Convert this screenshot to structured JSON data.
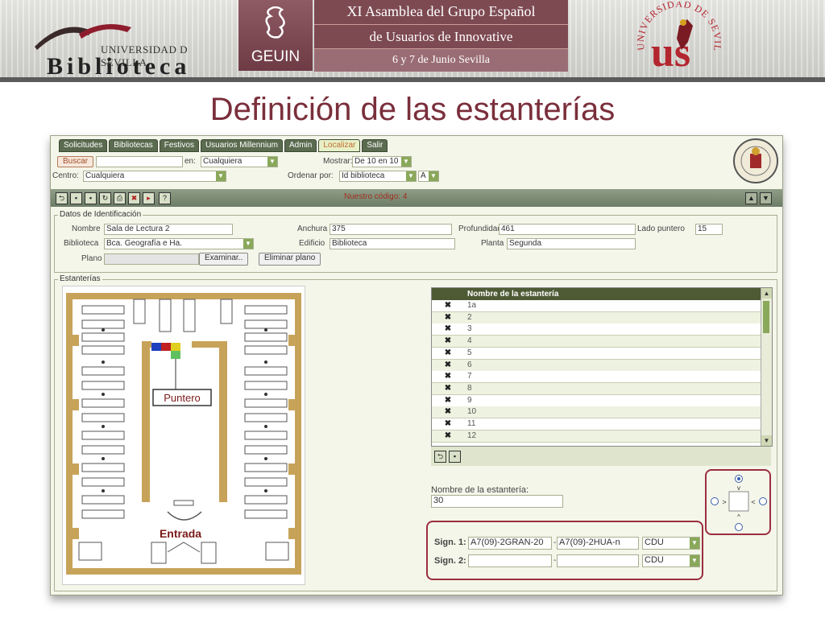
{
  "banner": {
    "library_sub": "UNIVERSIDAD D SEVILLA",
    "library_title": "Biblioteca",
    "geuin_label": "GEUIN",
    "event_line1": "XI Asamblea del Grupo Español",
    "event_line2": "de Usuarios de Innovative",
    "event_line3": "6 y 7 de Junio Sevilla",
    "crest_text": "UNIVERSIDAD DE SEVILLA",
    "crest_letters": "us"
  },
  "slide": {
    "title": "Definición de las estanterías"
  },
  "app": {
    "tabs": [
      {
        "label": "Solicitudes",
        "active": false
      },
      {
        "label": "Bibliotecas",
        "active": false
      },
      {
        "label": "Festivos",
        "active": false
      },
      {
        "label": "Usuarios Millennium",
        "active": false
      },
      {
        "label": "Admin",
        "active": false
      },
      {
        "label": "Localizar",
        "active": true
      },
      {
        "label": "Salir",
        "active": false
      }
    ],
    "search": {
      "button": "Buscar",
      "in_label": "en:",
      "in_value": "Cualquiera",
      "show_label": "Mostrar:",
      "show_value": "De 10 en 10",
      "center_label": "Centro:",
      "center_value": "Cualquiera",
      "order_label": "Ordenar por:",
      "order_value": "Id biblioteca",
      "order_dir": "A"
    },
    "toolbar": {
      "code_text": "Nuestro código: 4"
    },
    "ident": {
      "legend": "Datos de Identificación",
      "nombre_label": "Nombre",
      "nombre_value": "Sala de Lectura 2",
      "anchura_label": "Anchura",
      "anchura_value": "375",
      "profundidad_label": "Profundidad",
      "profundidad_value": "461",
      "lado_label": "Lado puntero",
      "lado_value": "15",
      "biblioteca_label": "Biblioteca",
      "biblioteca_value": "Bca. Geografía e Ha.",
      "edificio_label": "Edificio",
      "edificio_value": "Biblioteca",
      "planta_label": "Planta",
      "planta_value": "Segunda",
      "plano_label": "Plano",
      "examinar_button": "Examinar..",
      "eliminar_button": "Eliminar plano"
    },
    "estanterias": {
      "legend": "Estanterías",
      "plan_pointer_label": "Puntero",
      "plan_entrance_label": "Entrada",
      "table_header": "Nombre de la estantería",
      "rows": [
        "1a",
        "2",
        "3",
        "4",
        "5",
        "6",
        "7",
        "8",
        "9",
        "10",
        "11",
        "12"
      ],
      "delete_glyph": "✖",
      "name_label": "Nombre de la estantería:",
      "name_value": "30",
      "sign1_label": "Sign. 1:",
      "sign1_from": "A7(09)-2GRAN-20",
      "sign1_to": "A7(09)-2HUA-n",
      "sign1_type": "CDU",
      "sign2_label": "Sign. 2:",
      "sign2_from": "",
      "sign2_to": "",
      "sign2_type": "CDU",
      "dash": "-"
    }
  }
}
